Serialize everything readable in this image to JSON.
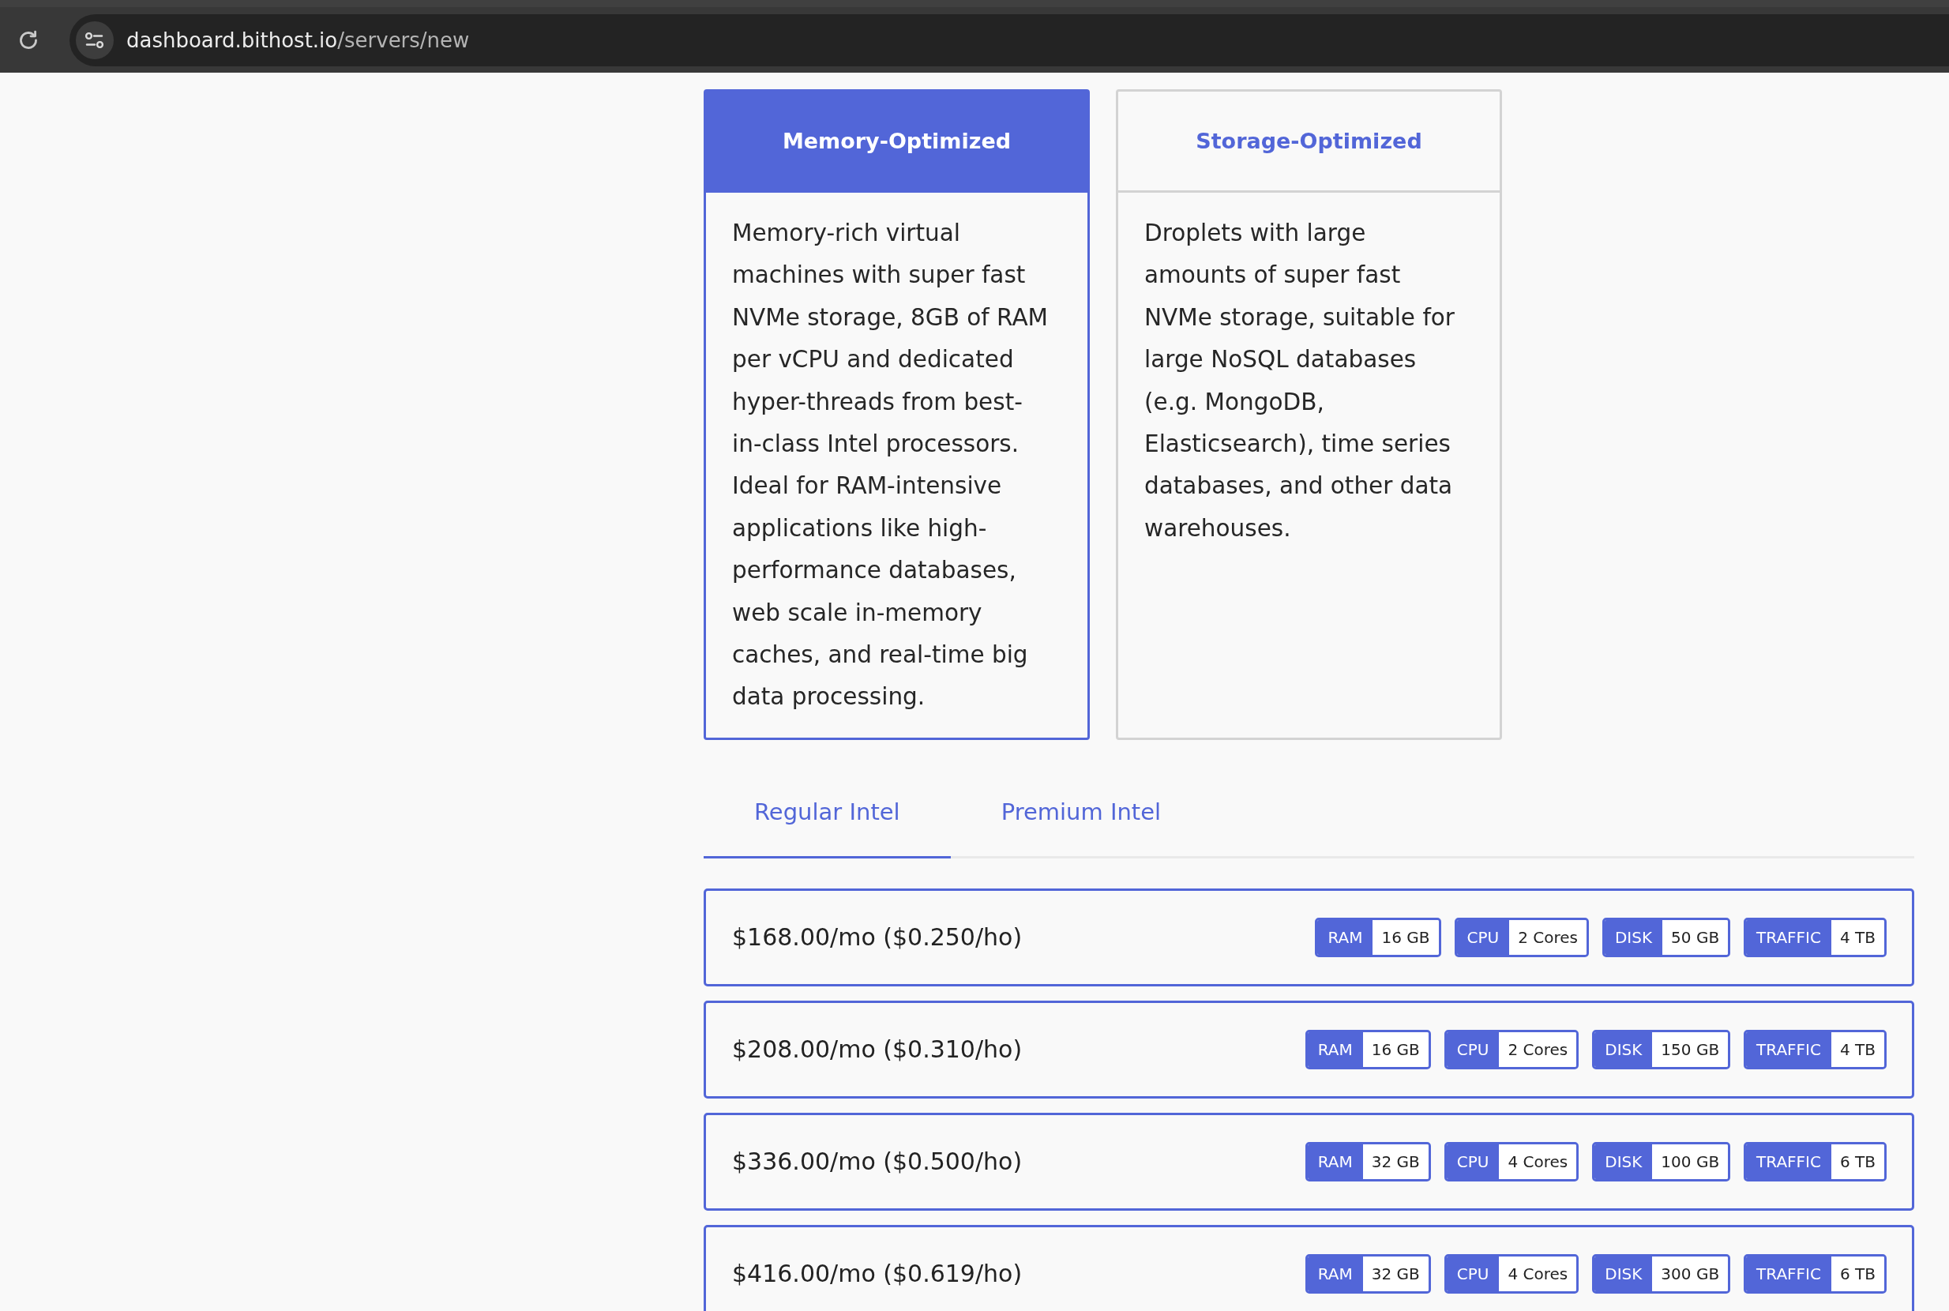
{
  "browser": {
    "url_host": "dashboard.bithost.io",
    "url_path": "/servers/new"
  },
  "categories": [
    {
      "title": "Memory-Optimized",
      "selected": true,
      "description": "Memory-rich virtual machines with super fast NVMe storage, 8GB of RAM per vCPU and dedicated hyper-threads from best-in-class Intel processors. Ideal for RAM-intensive applications like high-performance databases, web scale in-memory caches, and real-time big data processing."
    },
    {
      "title": "Storage-Optimized",
      "selected": false,
      "description": "Droplets with large amounts of super fast NVMe storage, suitable for large NoSQL databases (e.g. MongoDB, Elasticsearch), time series databases, and other data warehouses."
    }
  ],
  "tabs": [
    {
      "label": "Regular Intel",
      "selected": true
    },
    {
      "label": "Premium Intel",
      "selected": false
    }
  ],
  "plans": [
    {
      "price": "$168.00/mo ($0.250/ho)",
      "specs": [
        {
          "label": "RAM",
          "value": "16 GB"
        },
        {
          "label": "CPU",
          "value": "2 Cores"
        },
        {
          "label": "DISK",
          "value": "50 GB"
        },
        {
          "label": "TRAFFIC",
          "value": "4 TB"
        }
      ]
    },
    {
      "price": "$208.00/mo ($0.310/ho)",
      "specs": [
        {
          "label": "RAM",
          "value": "16 GB"
        },
        {
          "label": "CPU",
          "value": "2 Cores"
        },
        {
          "label": "DISK",
          "value": "150 GB"
        },
        {
          "label": "TRAFFIC",
          "value": "4 TB"
        }
      ]
    },
    {
      "price": "$336.00/mo ($0.500/ho)",
      "specs": [
        {
          "label": "RAM",
          "value": "32 GB"
        },
        {
          "label": "CPU",
          "value": "4 Cores"
        },
        {
          "label": "DISK",
          "value": "100 GB"
        },
        {
          "label": "TRAFFIC",
          "value": "6 TB"
        }
      ]
    },
    {
      "price": "$416.00/mo ($0.619/ho)",
      "specs": [
        {
          "label": "RAM",
          "value": "32 GB"
        },
        {
          "label": "CPU",
          "value": "4 Cores"
        },
        {
          "label": "DISK",
          "value": "300 GB"
        },
        {
          "label": "TRAFFIC",
          "value": "6 TB"
        }
      ]
    }
  ]
}
